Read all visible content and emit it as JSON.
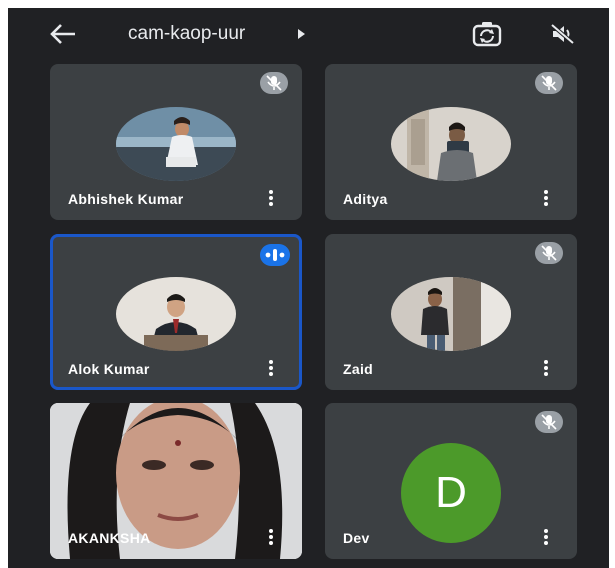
{
  "meeting": {
    "title": "cam-kaop-uur"
  },
  "participants": [
    {
      "name": "Abhishek Kumar",
      "muted": true
    },
    {
      "name": "Aditya",
      "muted": true
    },
    {
      "name": "Alok Kumar",
      "muted": false,
      "speaking": true
    },
    {
      "name": "Zaid",
      "muted": true
    },
    {
      "name": "AKANKSHA",
      "muted": false,
      "video_on": true
    },
    {
      "name": "Dev",
      "muted": true,
      "avatar_letter": "D",
      "avatar_color": "#4c9a2a"
    }
  ],
  "colors": {
    "background": "#202124",
    "tile": "#3c4043",
    "active_border": "#1a57c9",
    "speaking_badge": "#1a73e8",
    "muted_badge": "#9aa0a6"
  },
  "icons": {
    "back": "arrow-left-icon",
    "dropdown": "caret-right-icon",
    "camera_switch": "camera-flip-icon",
    "speaker": "speaker-off-icon",
    "mic": "mic-off-icon",
    "more": "more-vertical-icon"
  }
}
